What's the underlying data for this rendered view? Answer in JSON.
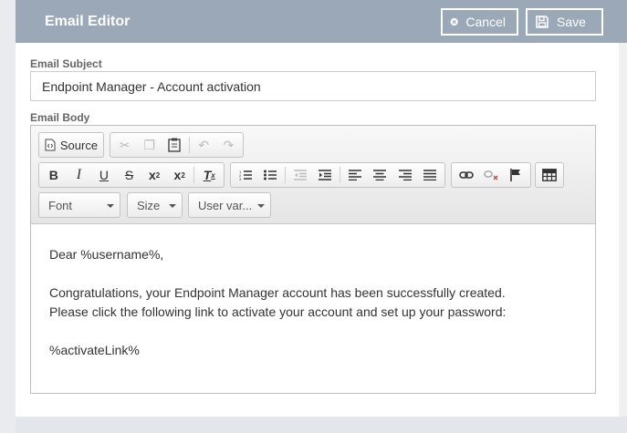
{
  "header": {
    "title": "Email Editor",
    "cancel_label": "Cancel",
    "save_label": "Save"
  },
  "subject": {
    "label": "Email Subject",
    "value": "Endpoint Manager - Account activation"
  },
  "body": {
    "label": "Email Body",
    "lines": [
      "Dear %username%,",
      "",
      "Congratulations, your Endpoint Manager account has been successfully created.",
      "Please click the following link to activate your account and set up your password:",
      "",
      "%activateLink%"
    ]
  },
  "toolbar": {
    "source_label": "Source",
    "font_label": "Font",
    "size_label": "Size",
    "uservar_label": "User var..."
  },
  "colors": {
    "header_bg": "#9aa8b8",
    "accent": "#ffffff"
  }
}
